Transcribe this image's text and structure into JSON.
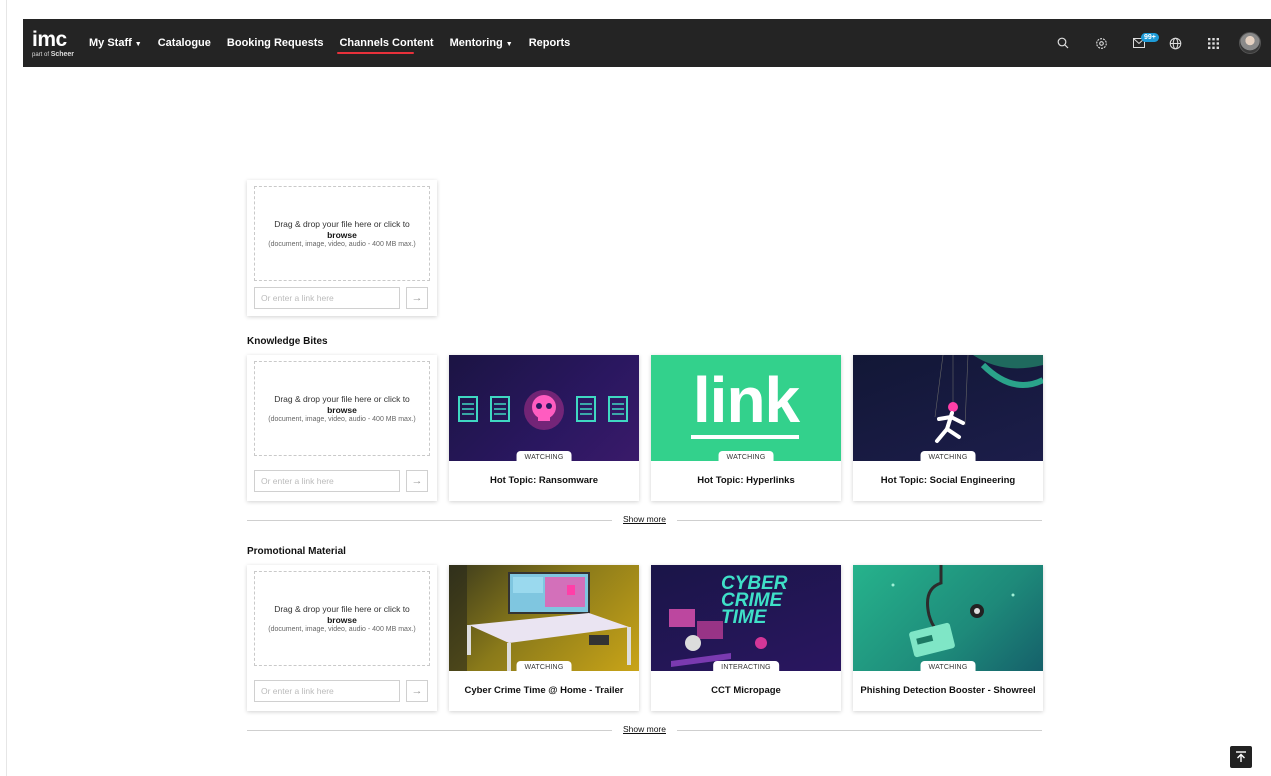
{
  "header": {
    "logo_main": "imc",
    "logo_sub_prefix": "part of",
    "logo_sub_brand": "Scheer",
    "nav": [
      {
        "label": "My Staff",
        "dropdown": true
      },
      {
        "label": "Catalogue",
        "dropdown": false
      },
      {
        "label": "Booking Requests",
        "dropdown": false
      },
      {
        "label": "Channels Content",
        "dropdown": false,
        "active": true
      },
      {
        "label": "Mentoring",
        "dropdown": true
      },
      {
        "label": "Reports",
        "dropdown": false
      }
    ],
    "icons": [
      "search-icon",
      "settings-icon",
      "messages-icon",
      "globe-icon",
      "apps-grid-icon",
      "avatar"
    ],
    "messages_badge": "99+"
  },
  "upload": {
    "drop_text": "Drag & drop your file here or click to",
    "browse": "browse",
    "hint": "(document, image, video, audio - 400 MB max.)",
    "link_placeholder": "Or enter a link here"
  },
  "sections": [
    {
      "title": "Knowledge Bites",
      "items": [
        {
          "title": "Hot Topic: Ransomware",
          "status": "WATCHING"
        },
        {
          "title": "Hot Topic: Hyperlinks",
          "status": "WATCHING"
        },
        {
          "title": "Hot Topic: Social Engineering",
          "status": "WATCHING"
        }
      ],
      "show_more": "Show more"
    },
    {
      "title": "Promotional Material",
      "items": [
        {
          "title": "Cyber Crime Time @ Home - Trailer",
          "status": "WATCHING"
        },
        {
          "title": "CCT Micropage",
          "status": "INTERACTING"
        },
        {
          "title": "Phishing Detection Booster - Showreel",
          "status": "WATCHING"
        }
      ],
      "show_more": "Show more"
    }
  ],
  "thumbnails": {
    "hyperlinks_text": "link",
    "cct_text_1": "CYBER",
    "cct_text_2": "CRIME",
    "cct_text_3": "TIME"
  },
  "colors": {
    "topbar": "#242424",
    "active_underline": "#e8313b",
    "badge": "#1e9bd7"
  }
}
